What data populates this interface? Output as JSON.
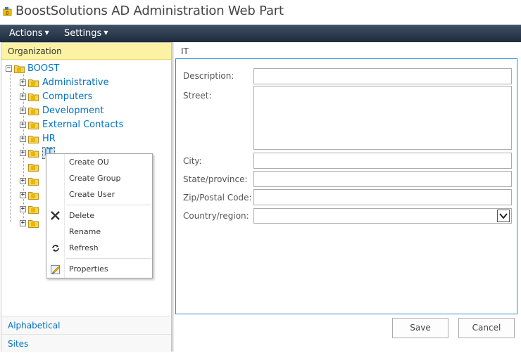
{
  "window": {
    "title": "BoostSolutions AD Administration Web Part"
  },
  "menubar": {
    "actions_label": "Actions",
    "settings_label": "Settings"
  },
  "left_panel": {
    "header": "Organization",
    "root": "BOOST",
    "items": [
      {
        "label": "Administrative"
      },
      {
        "label": "Computers"
      },
      {
        "label": "Development"
      },
      {
        "label": "External Contacts"
      },
      {
        "label": "HR"
      },
      {
        "label": "IT"
      }
    ],
    "footer_alphabetical": "Alphabetical",
    "footer_sites": "Sites"
  },
  "right_panel": {
    "breadcrumb": "IT",
    "fields": {
      "description_label": "Description:",
      "street_label": "Street:",
      "city_label": "City:",
      "state_label": "State/province:",
      "zip_label": "Zip/Postal Code:",
      "country_label": "Country/region:"
    },
    "save_label": "Save",
    "cancel_label": "Cancel"
  },
  "context_menu": {
    "create_ou": "Create OU",
    "create_group": "Create Group",
    "create_user": "Create User",
    "delete": "Delete",
    "rename": "Rename",
    "refresh": "Refresh",
    "properties": "Properties"
  },
  "colors": {
    "header_highlight": "#fbf3a3",
    "link_blue": "#0072c6",
    "menubar_dark": "#1d2b3c",
    "form_border": "#2a8dd4"
  }
}
